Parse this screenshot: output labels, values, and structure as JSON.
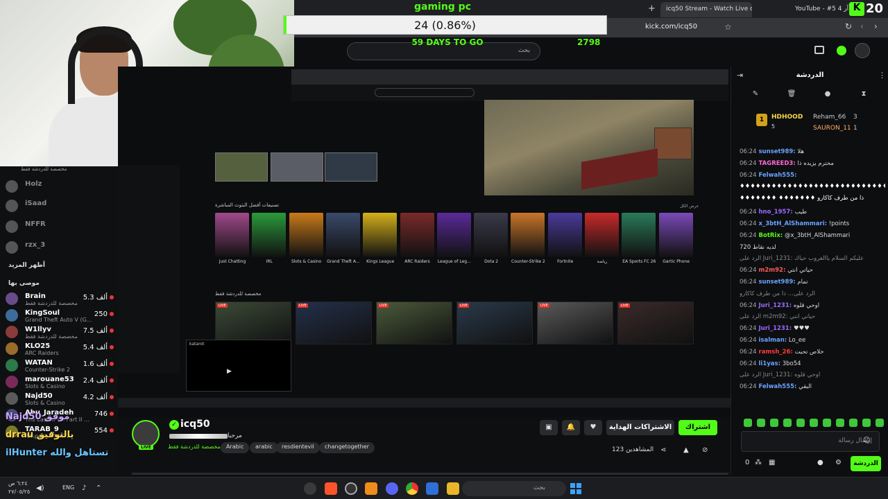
{
  "browser": {
    "tabs": [
      {
        "label": "icq50 Stream - Watch Live on"
      },
      {
        "label": "YouTube - #5 فى آر 4"
      }
    ],
    "url": "kick.com/icq50",
    "tab_badge": "20"
  },
  "goal": {
    "title": "gaming pc",
    "progress_text": "24 (0.86%)",
    "progress_fraction": 0.0086,
    "days_left": "59 DAYS TO GO",
    "target": "2798"
  },
  "search": {
    "placeholder": "بحث"
  },
  "left_sidebar": {
    "top_label": "مخصصة للدردشة فقط",
    "offline": [
      {
        "name": "Holz"
      },
      {
        "name": "iSaad"
      },
      {
        "name": "NFFR"
      },
      {
        "name": "rzx_3"
      }
    ],
    "show_more": "أظهر المزيد",
    "recommended_title": "موصى بها",
    "recommended": [
      {
        "name": "Brain",
        "sub": "مخصصة للدردشة فقط",
        "count": "5.3 ألف",
        "color": "#6a4b8a"
      },
      {
        "name": "KingSoul",
        "sub": "Grand Theft Auto V (G...",
        "count": "250",
        "color": "#3d6b9a"
      },
      {
        "name": "W1llyv",
        "sub": "مخصصة للدردشة فقط",
        "count": "7.5 ألف",
        "color": "#8a3b3b"
      },
      {
        "name": "KLO25",
        "sub": "ARC Raiders",
        "count": "5.4 ألف",
        "color": "#9a6b2a"
      },
      {
        "name": "WATAN",
        "sub": "Counter-Strike 2",
        "count": "1.6 ألف",
        "color": "#2a7a4a"
      },
      {
        "name": "marouane53",
        "sub": "Slots & Casino",
        "count": "2.4 ألف",
        "color": "#7a2a5a"
      },
      {
        "name": "Najd50",
        "sub": "Slots & Casino",
        "count": "4.2 ألف",
        "color": "#5a5a5a"
      },
      {
        "name": "Abu_Jaradeh",
        "sub": "The Last of Us Part II ...",
        "count": "746",
        "color": "#4a4a7a"
      },
      {
        "name": "TARAB_9",
        "sub": "Respect RP (GTA)",
        "count": "554",
        "color": "#7a7a2a"
      }
    ]
  },
  "overlays": {
    "alert1": "Najd50 موفق",
    "alert2": "drrau بالتوفيق",
    "alert3": "ilHunter تستاهل والله"
  },
  "nested": {
    "categories_label": "تصنيفات أفضل البثوث المباشرة",
    "categories": [
      {
        "name": "Just Chatting",
        "color": "#a04a8a"
      },
      {
        "name": "IRL",
        "color": "#2a9a3a"
      },
      {
        "name": "Slots & Casino",
        "color": "#c87a1a"
      },
      {
        "name": "Grand Theft A...",
        "color": "#3a4a6a"
      },
      {
        "name": "Kings League",
        "color": "#d4b01a"
      },
      {
        "name": "ARC Raiders",
        "color": "#7a2a2a"
      },
      {
        "name": "League of Leg...",
        "color": "#5a2a9a"
      },
      {
        "name": "Dota 2",
        "color": "#3a3a4a"
      },
      {
        "name": "Counter-Strike 2",
        "color": "#c8762a"
      },
      {
        "name": "Fortnite",
        "color": "#4a3a9a"
      },
      {
        "name": "رياضة",
        "color": "#c82a2a"
      },
      {
        "name": "EA Sports FC 26",
        "color": "#2a7a5a"
      },
      {
        "name": "Gartic Phone",
        "color": "#7a4ab8"
      }
    ],
    "live_label": "مخصصة للدردشة فقط",
    "mini_player_name": "katarot",
    "show_all": "عرض الكل"
  },
  "channel": {
    "name": "icq50",
    "title": "مرحبا",
    "category": "مخصصة للدردشة فقط",
    "tags": [
      "Arabic",
      "arabic",
      "resdientevil",
      "changetogether"
    ],
    "viewers_label": "المشاهدين",
    "viewers": "123",
    "subscribe_label": "اشتراك",
    "gift_label": "الاشتراكات الهداية"
  },
  "chat": {
    "header": "الدردشة",
    "pinned": [
      {
        "name": "HDHOOD",
        "count": "5",
        "rank": "1"
      },
      {
        "name": "Reham_66",
        "count": "3"
      },
      {
        "name": "SAURON_11",
        "count": "1"
      }
    ],
    "messages": [
      {
        "time": "06:24",
        "user": "sunset989:",
        "text": "هلا",
        "color": "#6aa3ff"
      },
      {
        "time": "06:24",
        "user": "TAGREED3:",
        "text": "محترم يزيده ذا",
        "color": "#ff6ad5"
      },
      {
        "time": "06:24",
        "user": "Felwah555:",
        "text": "",
        "color": "#6aa3ff"
      },
      {
        "time": "",
        "user": "",
        "text": "♦♦♦♦♦♦♦♦♦♦♦♦♦♦♦♦♦♦♦♦♦♦♦♦♦♦♦♦♦♦",
        "color": "#fff"
      },
      {
        "time": "",
        "user": "",
        "text": "♦♦♦♦♦♦♦ ♦♦♦♦♦♦♦ ذا من طرف كاكارو",
        "color": "#fff"
      },
      {
        "time": "06:24",
        "user": "hno_1957:",
        "text": "طيب",
        "color": "#9a6aff"
      },
      {
        "time": "06:24",
        "user": "x_3btH_AlShammari:",
        "text": "!points",
        "color": "#6aa3ff"
      },
      {
        "time": "06:24",
        "user": "BotRix:",
        "text": "@x_3btH_AlShammari",
        "color": "#53fc18"
      },
      {
        "time": "",
        "user": "",
        "text": "لديه نقاط 720",
        "color": "#ddd"
      },
      {
        "time": "",
        "user": "",
        "text": "الرد على Juri_1231: عليكم السلام ياالغروب حياك",
        "color": "#888"
      },
      {
        "time": "06:24",
        "user": "m2m92:",
        "text": "حياتي انتي",
        "color": "#ff5a5a"
      },
      {
        "time": "06:24",
        "user": "sunset989:",
        "text": "تمام",
        "color": "#6aa3ff"
      },
      {
        "time": "",
        "user": "",
        "text": "الرد على... ذا من طرف كاكارو",
        "color": "#888"
      },
      {
        "time": "06:24",
        "user": "Juri_1231:",
        "text": "اوحي قلوه",
        "color": "#9a6aff"
      },
      {
        "time": "",
        "user": "",
        "text": "الرد على m2m92: حياتي انتي",
        "color": "#888"
      },
      {
        "time": "06:24",
        "user": "Juri_1231:",
        "text": "♥♥♥",
        "color": "#9a6aff"
      },
      {
        "time": "06:24",
        "user": "isalman:",
        "text": "Lo_ee",
        "color": "#6aa3ff"
      },
      {
        "time": "06:24",
        "user": "ramsh_26:",
        "text": "خلاص تحبت",
        "color": "#ff3b3b"
      },
      {
        "time": "06:24",
        "user": "li1yas:",
        "text": "3bo54",
        "color": "#6aa3ff"
      },
      {
        "time": "",
        "user": "",
        "text": "الرد على Juri_1231: اوحي قلوه",
        "color": "#888"
      },
      {
        "time": "06:24",
        "user": "Felwah555:",
        "text": "البقي",
        "color": "#6aa3ff"
      }
    ],
    "input_placeholder": "إرسال رسالة",
    "send_label": "الدردشة",
    "points": "0"
  },
  "taskbar": {
    "search_placeholder": "بحث",
    "lang": "ENG",
    "time": "٦:٢٤ ص",
    "date": "٢٧/٠٥/٢٥"
  },
  "colors": {
    "accent": "#53fc18",
    "bg": "#0e0f11",
    "live": "#e3322b"
  }
}
